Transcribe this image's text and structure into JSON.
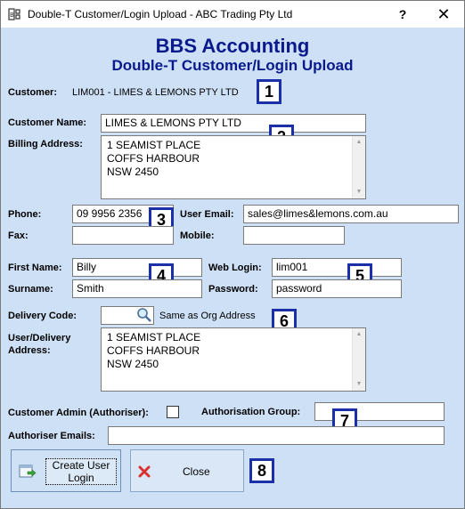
{
  "window": {
    "title": "Double-T Customer/Login Upload - ABC Trading Pty Ltd",
    "help": "?",
    "close": "✕"
  },
  "header": {
    "line1": "BBS Accounting",
    "line2": "Double-T Customer/Login Upload"
  },
  "customer": {
    "label": "Customer:",
    "value": "LIM001 - LIMES & LEMONS PTY LTD"
  },
  "customer_name": {
    "label": "Customer Name:",
    "value": "LIMES & LEMONS PTY LTD"
  },
  "billing": {
    "label": "Billing Address:",
    "lines": [
      "1 SEAMIST PLACE",
      "COFFS HARBOUR",
      "NSW 2450"
    ]
  },
  "phone": {
    "label": "Phone:",
    "value": "09 9956 2356"
  },
  "user_email": {
    "label": "User Email:",
    "value": "sales@limes&lemons.com.au"
  },
  "fax": {
    "label": "Fax:",
    "value": ""
  },
  "mobile": {
    "label": "Mobile:",
    "value": ""
  },
  "first_name": {
    "label": "First Name:",
    "value": "Billy"
  },
  "surname": {
    "label": "Surname:",
    "value": "Smith"
  },
  "web_login": {
    "label": "Web Login:",
    "value": "lim001"
  },
  "password": {
    "label": "Password:",
    "value": "password"
  },
  "delivery_code": {
    "label": "Delivery Code:",
    "value": "",
    "same_as_org": "Same as Org Address"
  },
  "delivery_address": {
    "label_line1": "User/Delivery",
    "label_line2": "Address:",
    "lines": [
      "1 SEAMIST PLACE",
      "COFFS HARBOUR",
      "NSW 2450"
    ]
  },
  "customer_admin": {
    "label": "Customer Admin (Authoriser):",
    "checked": false
  },
  "auth_group": {
    "label": "Authorisation Group:",
    "value": ""
  },
  "auth_emails": {
    "label": "Authoriser Emails:",
    "value": ""
  },
  "buttons": {
    "create_line1": "Create User",
    "create_line2": "Login",
    "close": "Close"
  },
  "badges": [
    "1",
    "2",
    "3",
    "4",
    "5",
    "6",
    "7",
    "8"
  ],
  "colors": {
    "heading": "#0a1a8c",
    "background": "#cde0f6",
    "badge_border": "#1b2fa8"
  }
}
